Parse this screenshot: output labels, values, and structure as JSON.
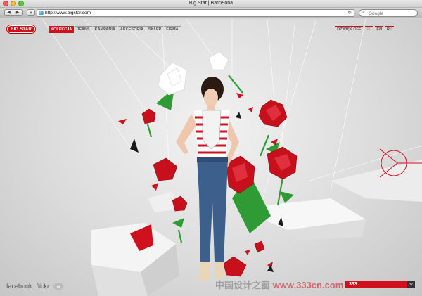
{
  "window": {
    "title": "Big Star | Barcelona"
  },
  "toolbar": {
    "back_icon": "back-arrow-icon",
    "forward_icon": "forward-arrow-icon",
    "add_icon": "plus-icon",
    "url": "http://www.bigstar.com",
    "reload_icon": "reload-icon",
    "search_placeholder": "Google"
  },
  "site": {
    "logo_text": "BIG STAR",
    "nav": [
      {
        "label": "KOLEKCJA",
        "active": true
      },
      {
        "label": "JEANS"
      },
      {
        "label": "KAMPANIA"
      },
      {
        "label": "AKCESORIA"
      },
      {
        "label": "SKLEP"
      },
      {
        "label": "FIRMA"
      }
    ],
    "sound_label": "DŹWIĘK OFF",
    "languages": [
      {
        "label": "PL",
        "active": true
      },
      {
        "label": "EN"
      },
      {
        "label": "RU"
      }
    ],
    "social": {
      "facebook": "facebook",
      "flickr": "flickr",
      "badge": "flickr-badge-icon"
    },
    "counter": {
      "value": "333",
      "button": "OK"
    },
    "watermark": {
      "part1": "中国设计之窗",
      "part2": "www.333cn.com"
    },
    "brand_color": "#d0101d"
  }
}
